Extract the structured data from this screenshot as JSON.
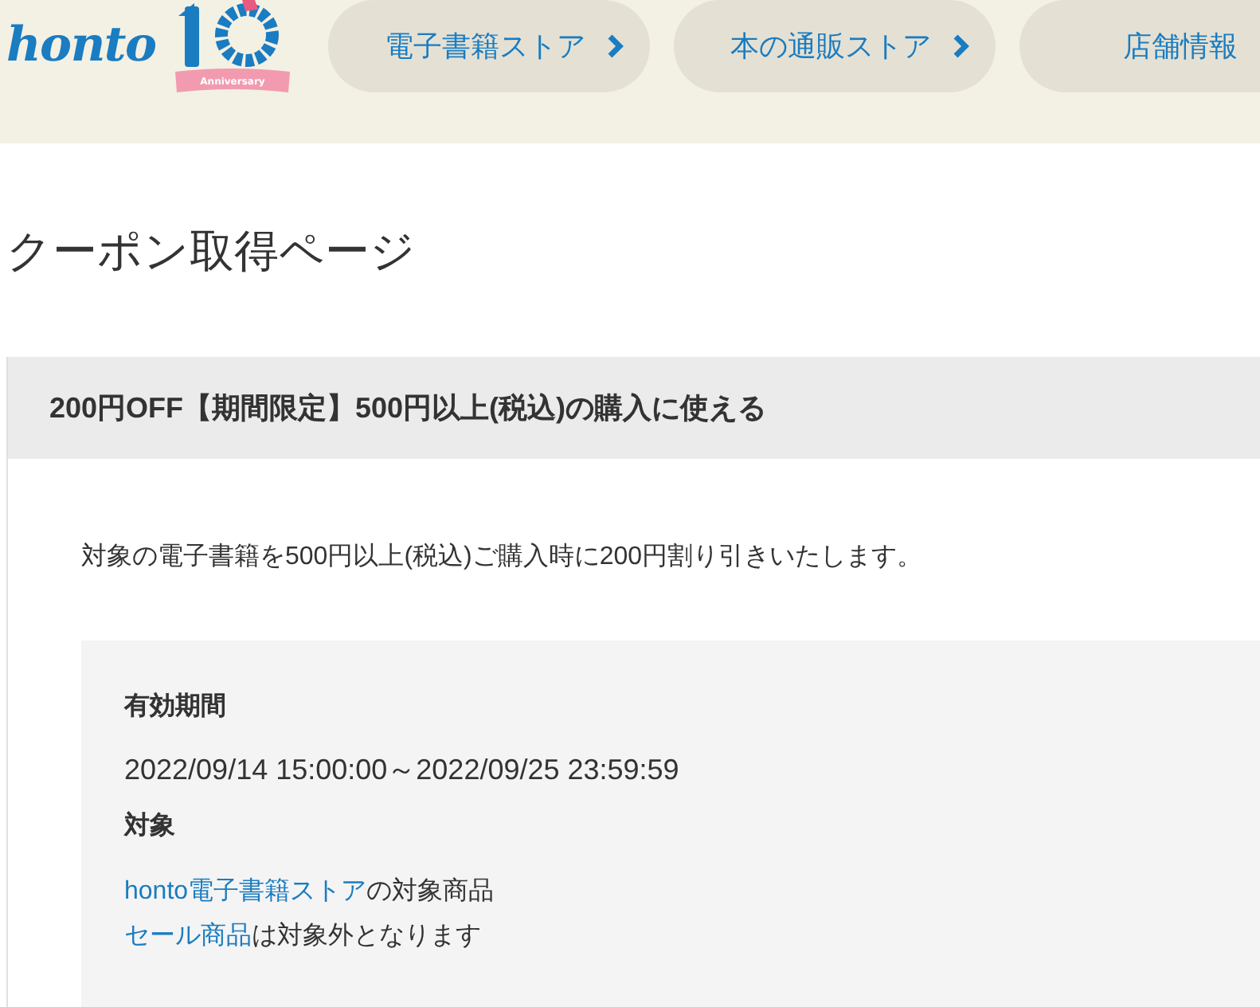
{
  "header": {
    "logo": "honto",
    "badge": "Anniversary",
    "nav": [
      {
        "label": "電子書籍ストア",
        "chevron": true
      },
      {
        "label": "本の通販ストア",
        "chevron": true
      },
      {
        "label": "店舗情報",
        "chevron": false
      }
    ]
  },
  "page_title": "クーポン取得ページ",
  "coupon": {
    "title": "200円OFF【期間限定】500円以上(税込)の購入に使える",
    "description": "対象の電子書籍を500円以上(税込)ご購入時に200円割り引きいたします。",
    "details": [
      {
        "label": "有効期間",
        "lines": [
          {
            "text": "2022/09/14 15:00:00～2022/09/25 23:59:59"
          }
        ]
      },
      {
        "label": "対象",
        "lines": [
          {
            "link": "honto電子書籍ストア",
            "text": "の対象商品"
          },
          {
            "link": "セール商品",
            "text": "は対象外となります"
          }
        ]
      }
    ]
  }
}
